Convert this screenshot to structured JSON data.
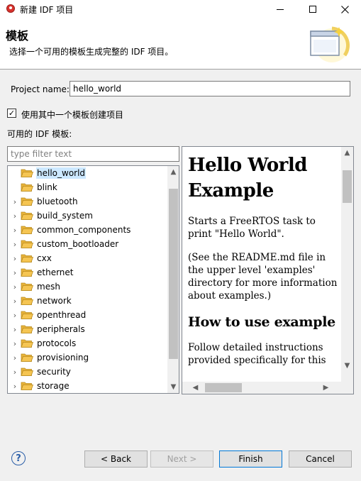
{
  "window": {
    "title": "新建 IDF 项目",
    "controls": {
      "minimize": "minimize",
      "maximize": "maximize",
      "close": "close"
    }
  },
  "banner": {
    "title": "模板",
    "description": "选择一个可用的模板生成完整的 IDF 项目。"
  },
  "form": {
    "project_name_label": "Project name:",
    "project_name_value": "hello_world",
    "use_template_label": "使用其中一个模板创建项目",
    "use_template_checked": true,
    "check_glyph": "✓",
    "available_templates_label": "可用的 IDF 模板:",
    "filter_placeholder": "type filter text"
  },
  "tree": {
    "items": [
      {
        "label": "hello_world",
        "expandable": false,
        "selected": true
      },
      {
        "label": "blink",
        "expandable": false,
        "selected": false
      },
      {
        "label": "bluetooth",
        "expandable": true,
        "selected": false
      },
      {
        "label": "build_system",
        "expandable": true,
        "selected": false
      },
      {
        "label": "common_components",
        "expandable": true,
        "selected": false
      },
      {
        "label": "custom_bootloader",
        "expandable": true,
        "selected": false
      },
      {
        "label": "cxx",
        "expandable": true,
        "selected": false
      },
      {
        "label": "ethernet",
        "expandable": true,
        "selected": false
      },
      {
        "label": "mesh",
        "expandable": true,
        "selected": false
      },
      {
        "label": "network",
        "expandable": true,
        "selected": false
      },
      {
        "label": "openthread",
        "expandable": true,
        "selected": false
      },
      {
        "label": "peripherals",
        "expandable": true,
        "selected": false
      },
      {
        "label": "protocols",
        "expandable": true,
        "selected": false
      },
      {
        "label": "provisioning",
        "expandable": true,
        "selected": false
      },
      {
        "label": "security",
        "expandable": true,
        "selected": false
      },
      {
        "label": "storage",
        "expandable": true,
        "selected": false
      }
    ]
  },
  "preview": {
    "heading": "Hello World Example",
    "paragraph1": "Starts a FreeRTOS task to print \"Hello World\".",
    "paragraph2": "(See the README.md file in the upper level 'examples' directory for more information about examples.)",
    "subheading": "How to use example",
    "paragraph3": "Follow detailed instructions provided specifically for this"
  },
  "buttons": {
    "help": "?",
    "back": "< Back",
    "next": "Next >",
    "finish": "Finish",
    "cancel": "Cancel"
  },
  "colors": {
    "selection": "#cce8ff",
    "default_button_border": "#0078d7",
    "folder_fill": "#f5c552"
  }
}
